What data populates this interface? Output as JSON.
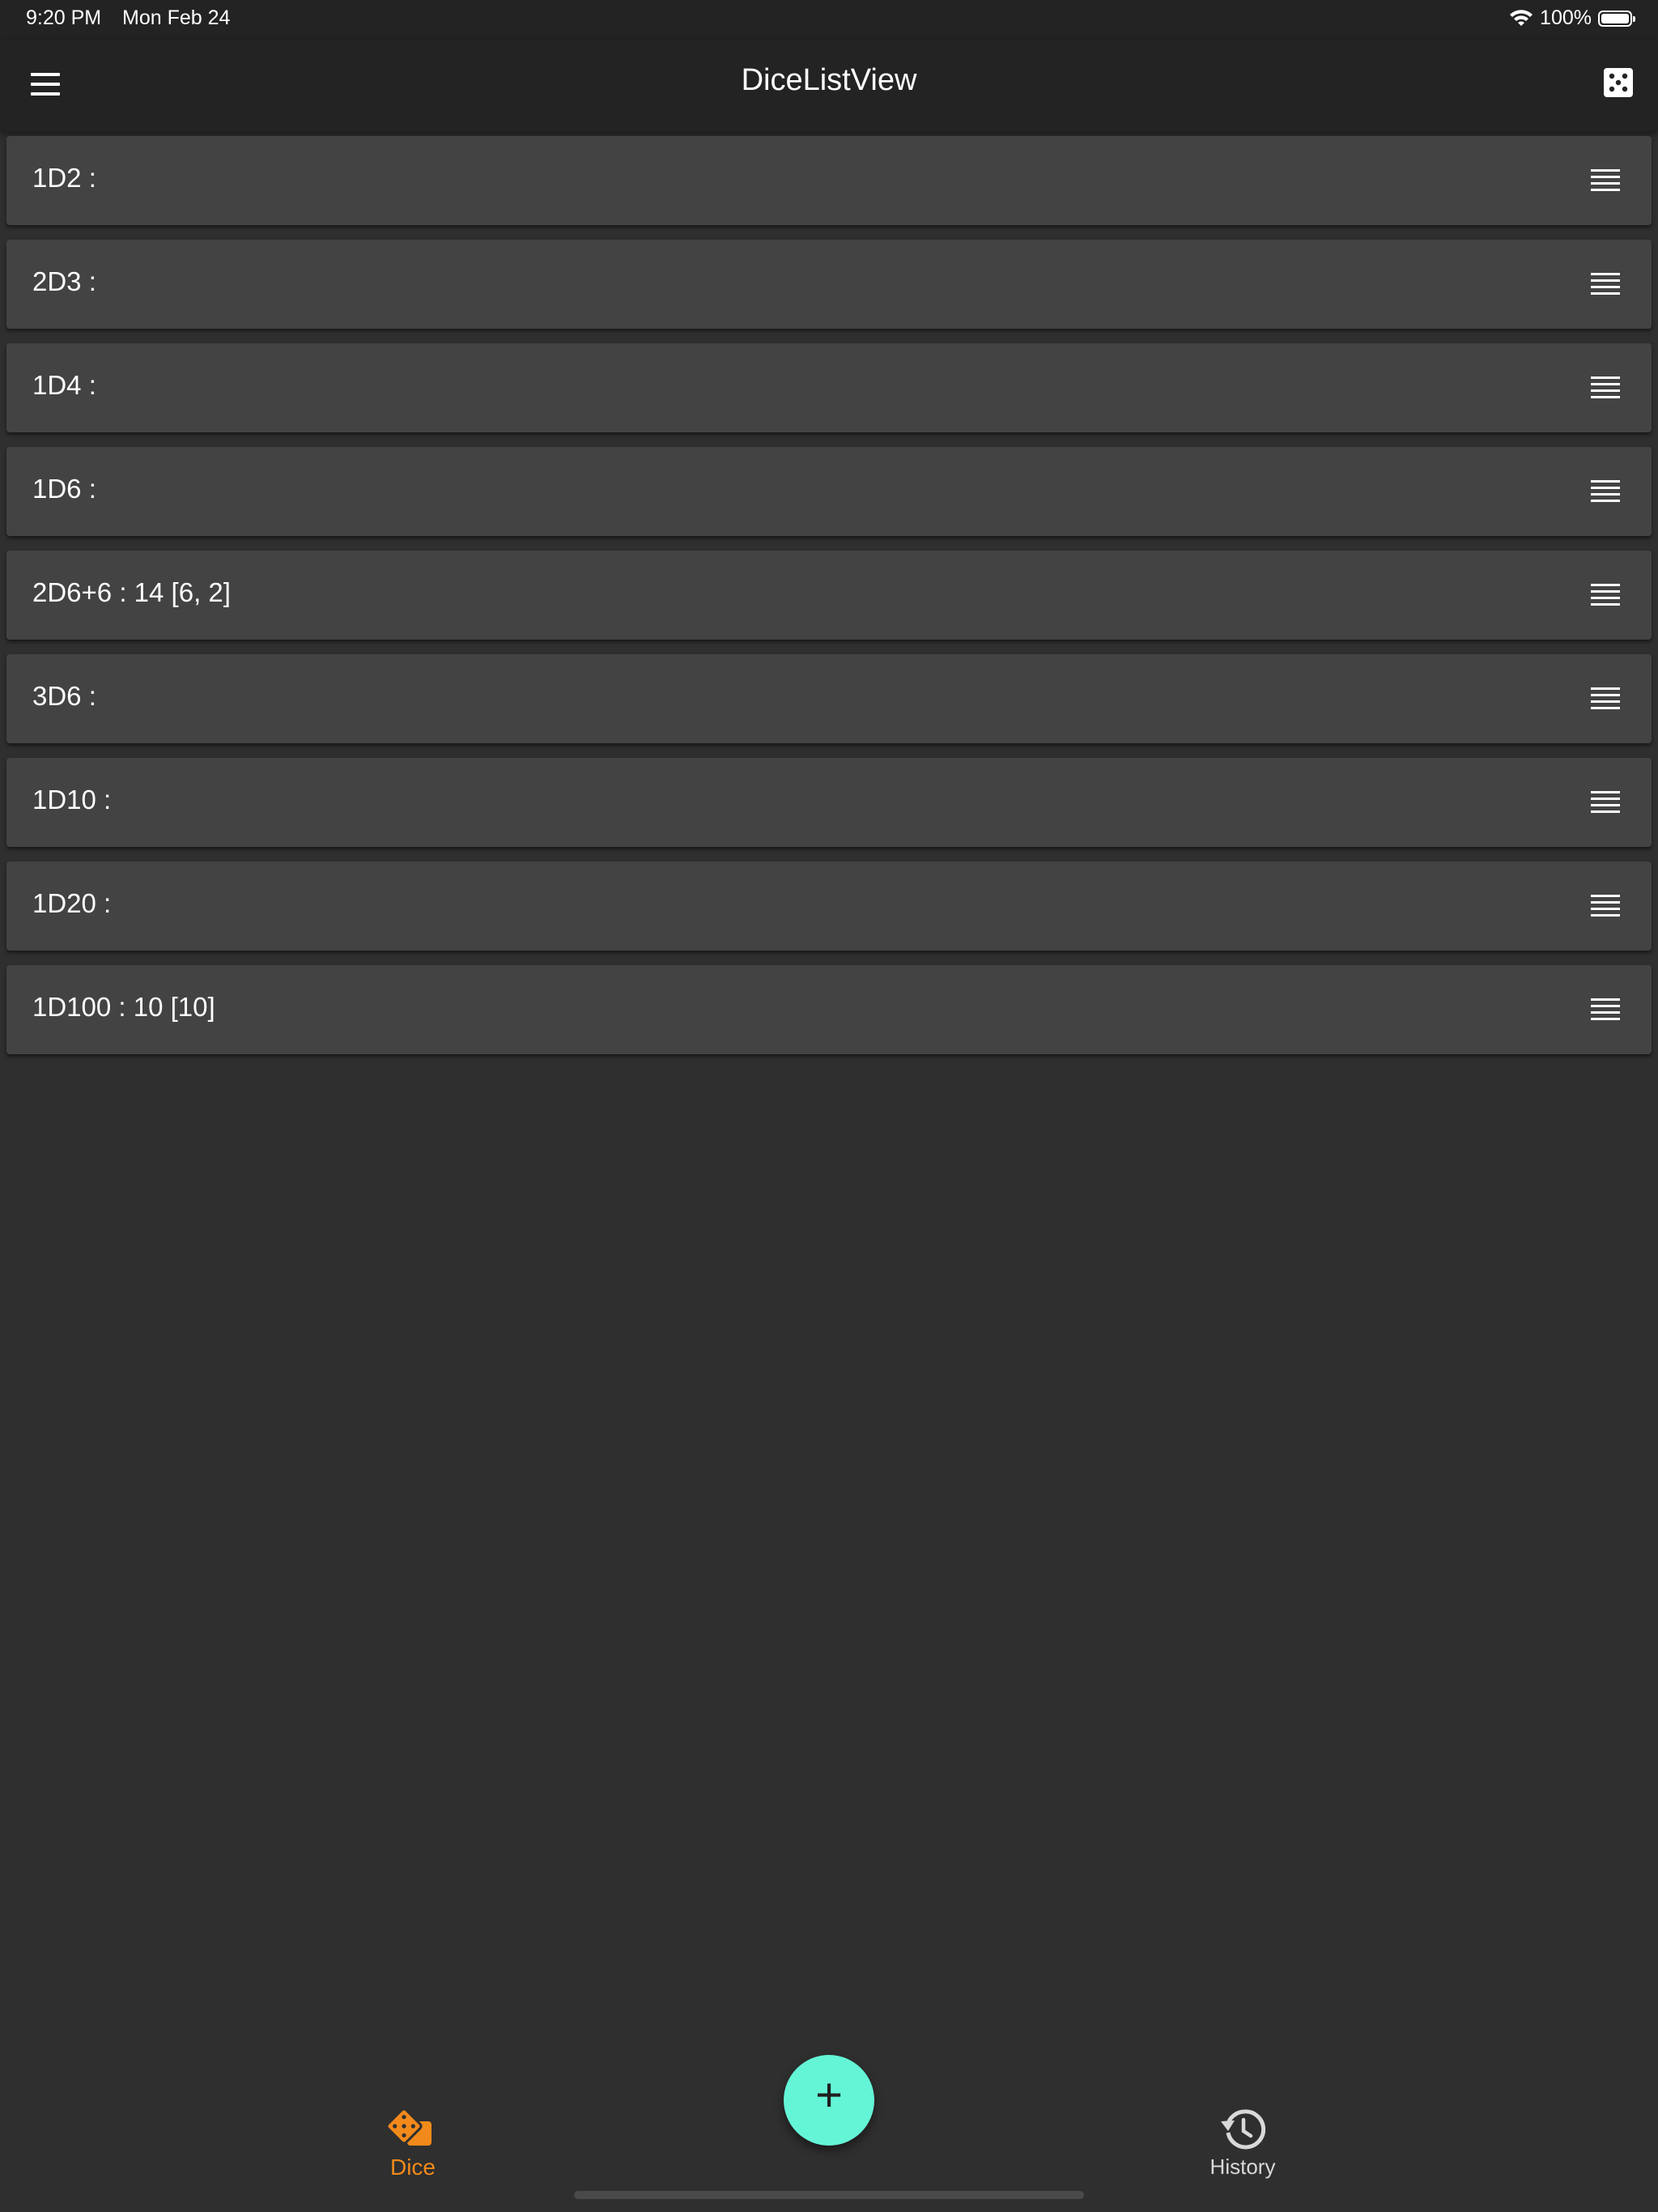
{
  "status_bar": {
    "time": "9:20 PM",
    "date": "Mon Feb 24",
    "battery": "100%"
  },
  "app_bar": {
    "title": "DiceListView"
  },
  "dice_list": [
    {
      "label": "1D2 :"
    },
    {
      "label": "2D3 :"
    },
    {
      "label": "1D4 :"
    },
    {
      "label": "1D6 :"
    },
    {
      "label": "2D6+6 : 14 [6, 2]"
    },
    {
      "label": "3D6 :"
    },
    {
      "label": "1D10 :"
    },
    {
      "label": "1D20 :"
    },
    {
      "label": "1D100 : 10 [10]"
    }
  ],
  "bottom_nav": {
    "dice_label": "Dice",
    "history_label": "History",
    "active": "Dice"
  },
  "fab": {
    "symbol": "+"
  },
  "colors": {
    "accent": "#f28a1b",
    "fab": "#64f5d7",
    "background": "#2f2f2f",
    "card": "#434343",
    "bar": "#232323"
  }
}
